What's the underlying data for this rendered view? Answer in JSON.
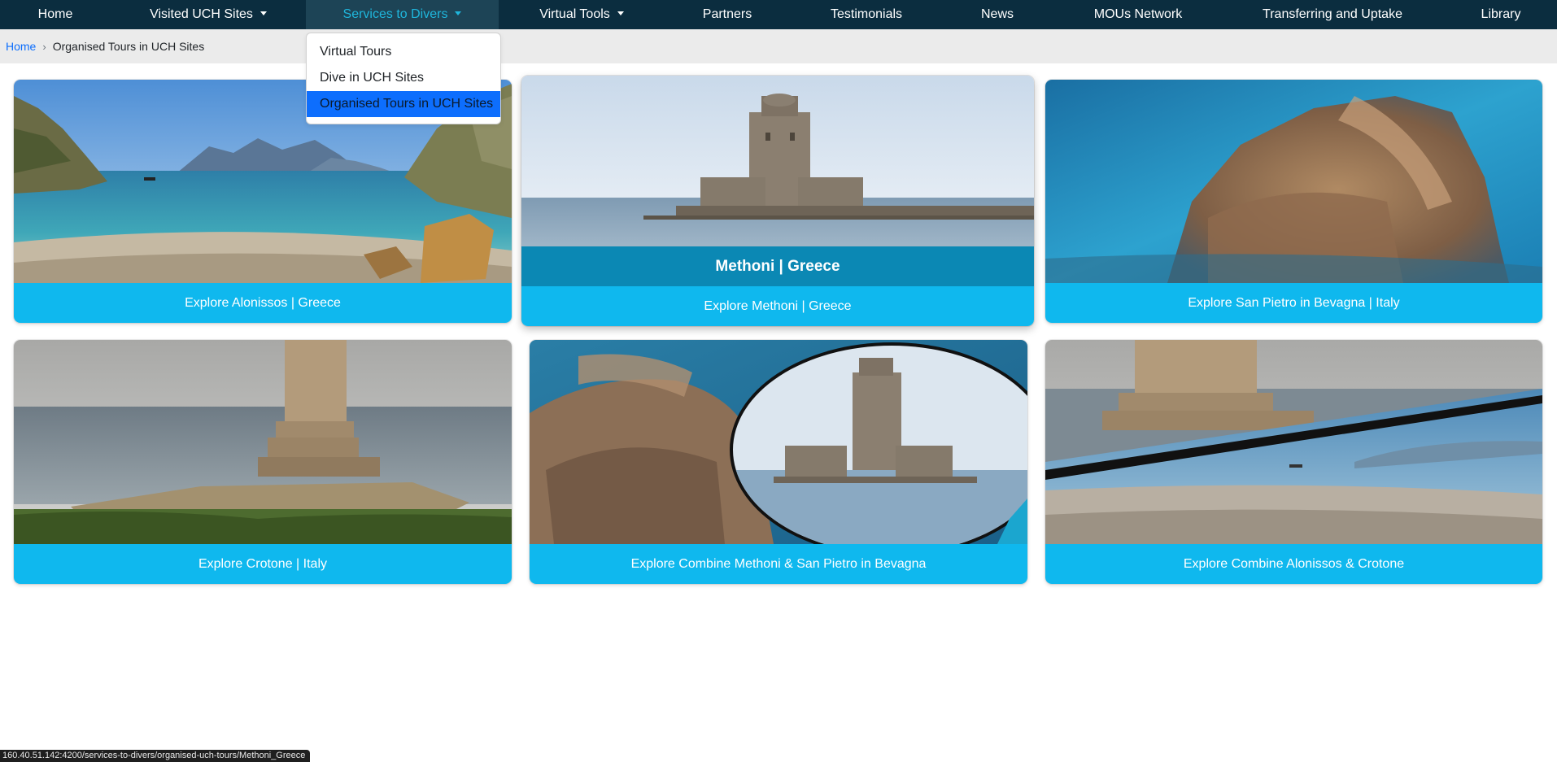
{
  "nav": {
    "home": "Home",
    "visited_sites": "Visited UCH Sites",
    "services_to_divers": "Services to Divers",
    "virtual_tools": "Virtual Tools",
    "partners": "Partners",
    "testimonials": "Testimonials",
    "news": "News",
    "mous_network": "MOUs Network",
    "transferring_uptake": "Transferring and Uptake",
    "library": "Library"
  },
  "dropdown": {
    "items": [
      "Virtual Tours",
      "Dive in UCH Sites",
      "Organised Tours in UCH Sites"
    ],
    "selected": "Organised Tours in UCH Sites"
  },
  "breadcrumb": {
    "home": "Home",
    "separator": "›",
    "current": "Organised Tours in UCH Sites"
  },
  "cards": [
    {
      "label": "Explore Alonissos | Greece"
    },
    {
      "label": "Explore Methoni | Greece",
      "hover_title": "Methoni | Greece"
    },
    {
      "label": "Explore San Pietro in Bevagna | Italy"
    },
    {
      "label": "Explore Crotone | Italy"
    },
    {
      "label": "Explore Combine Methoni & San Pietro in Bevagna"
    },
    {
      "label": "Explore Combine Alonissos & Crotone"
    }
  ],
  "status_url": "160.40.51.142:4200/services-to-divers/organised-uch-tours/Methoni_Greece",
  "colors": {
    "nav_bg": "#0b2d3f",
    "nav_active_text": "#1fb6dc",
    "card_button": "#0fb8ee",
    "card_hover_title": "#0b88b4",
    "dropdown_selected": "#0d6efd"
  }
}
